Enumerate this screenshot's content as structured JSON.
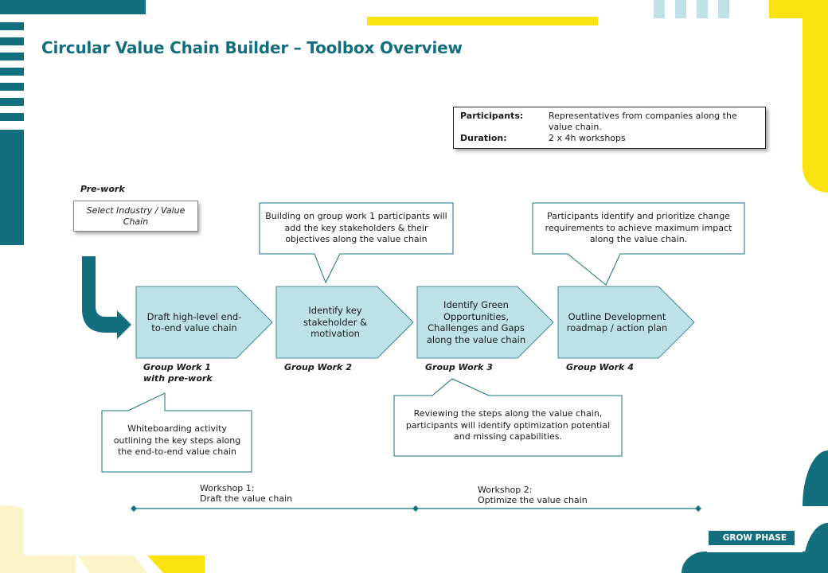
{
  "title": "Circular Value Chain Builder – Toolbox Overview",
  "info": {
    "participants_label": "Participants:",
    "participants_value": "Representatives  from companies along the value chain.",
    "duration_label": "Duration:",
    "duration_value": "2 x 4h workshops"
  },
  "prework": {
    "label": "Pre-work",
    "box_text": "Select Industry / Value Chain"
  },
  "steps": [
    {
      "text": "Draft high-level end-to-end value chain",
      "group": "Group Work 1",
      "group_sub": "with pre-work"
    },
    {
      "text": "Identify key stakeholder & motivation",
      "group": "Group Work 2",
      "group_sub": ""
    },
    {
      "text": "Identify Green Opportunities, Challenges and Gaps along the value chain",
      "group": "Group Work 3",
      "group_sub": ""
    },
    {
      "text": "Outline Development roadmap / action plan",
      "group": "Group Work 4",
      "group_sub": ""
    }
  ],
  "callouts": {
    "step1": "Whiteboarding activity outlining the key steps along the end-to-end value chain",
    "step2": "Building on group work 1 participants will add the key stakeholders & their objectives along the value chain",
    "step3": "Reviewing the steps along the value chain, participants will identify optimization potential and missing capabilities.",
    "step4": "Participants identify and prioritize change requirements to achieve maximum impact along the value chain."
  },
  "workshops": [
    {
      "title": "Workshop 1:",
      "subtitle": "Draft  the value chain"
    },
    {
      "title": "Workshop 2:",
      "subtitle": "Optimize the value chain"
    }
  ],
  "phase_badge": "GROW PHASE",
  "colors": {
    "teal": "#136f7d",
    "step_fill": "#bde1e6",
    "yellow": "#fae311",
    "light_yellow": "#fbf4c8",
    "light_blue": "#bde1e6"
  }
}
